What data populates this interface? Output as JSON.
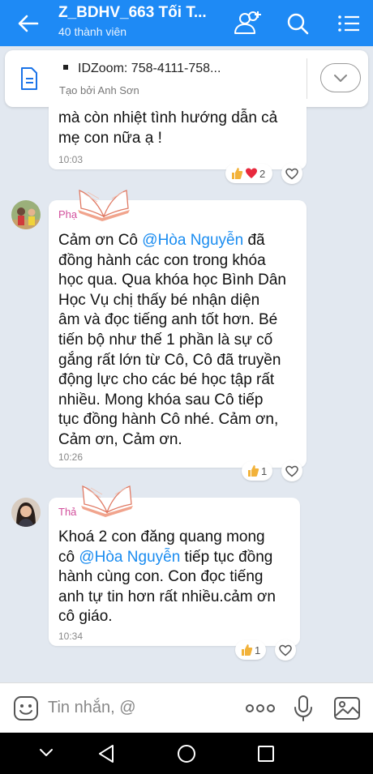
{
  "header": {
    "title": "Z_BDHV_663 Tối T...",
    "subtitle": "40 thành viên"
  },
  "pinned": {
    "line1": "IDZoom: 758-4111-758...",
    "line2": "Tạo bởi Anh Sơn"
  },
  "messages": [
    {
      "lines": [
        "mà còn nhiệt tình hướng dẫn cả",
        "mẹ con nữa ạ !"
      ],
      "time": "10:03",
      "reaction_count": "2"
    },
    {
      "sender": "Phạ",
      "pre": "Cảm ơn Cô ",
      "mention": "@Hòa Nguyễn",
      "post": " đã",
      "lines": [
        "đồng hành các con trong khóa",
        "học qua. Qua khóa học Bình Dân",
        "Học Vụ chị thấy bé nhận diện",
        "âm và đọc tiếng anh tốt hơn. Bé",
        "tiến bộ như thế 1 phần là sự cố",
        "gắng rất lớn từ Cô, Cô đã truyền",
        "động lực cho các bé học tập rất",
        "nhiều. Mong khóa sau Cô tiếp",
        "tục đồng hành Cô nhé. Cảm ơn,",
        "Cảm ơn, Cảm ơn."
      ],
      "time": "10:26",
      "reaction_count": "1"
    },
    {
      "sender": "Thả",
      "line1": "Khoá 2 con đăng quang mong",
      "pre": "cô ",
      "mention": "@Hòa Nguyễn",
      "post": " tiếp tục đồng",
      "lines": [
        "hành cùng con. Con đọc tiếng",
        "anh tự tin hơn rất nhiều.cảm ơn",
        "cô giáo."
      ],
      "time": "10:34",
      "reaction_count": "1"
    }
  ],
  "input": {
    "placeholder": "Tin nhắn, @"
  },
  "colors": {
    "header": "#1e8af5",
    "mention": "#1a8cf0",
    "background": "#e2e8f0"
  },
  "icons": [
    "back-arrow-icon",
    "add-member-icon",
    "search-icon",
    "menu-list-icon",
    "document-icon",
    "chevron-down-icon",
    "like-icon",
    "heart-icon",
    "sticker-icon",
    "more-icon",
    "microphone-icon",
    "image-icon",
    "nav-back-icon",
    "nav-home-icon",
    "nav-recents-icon"
  ]
}
